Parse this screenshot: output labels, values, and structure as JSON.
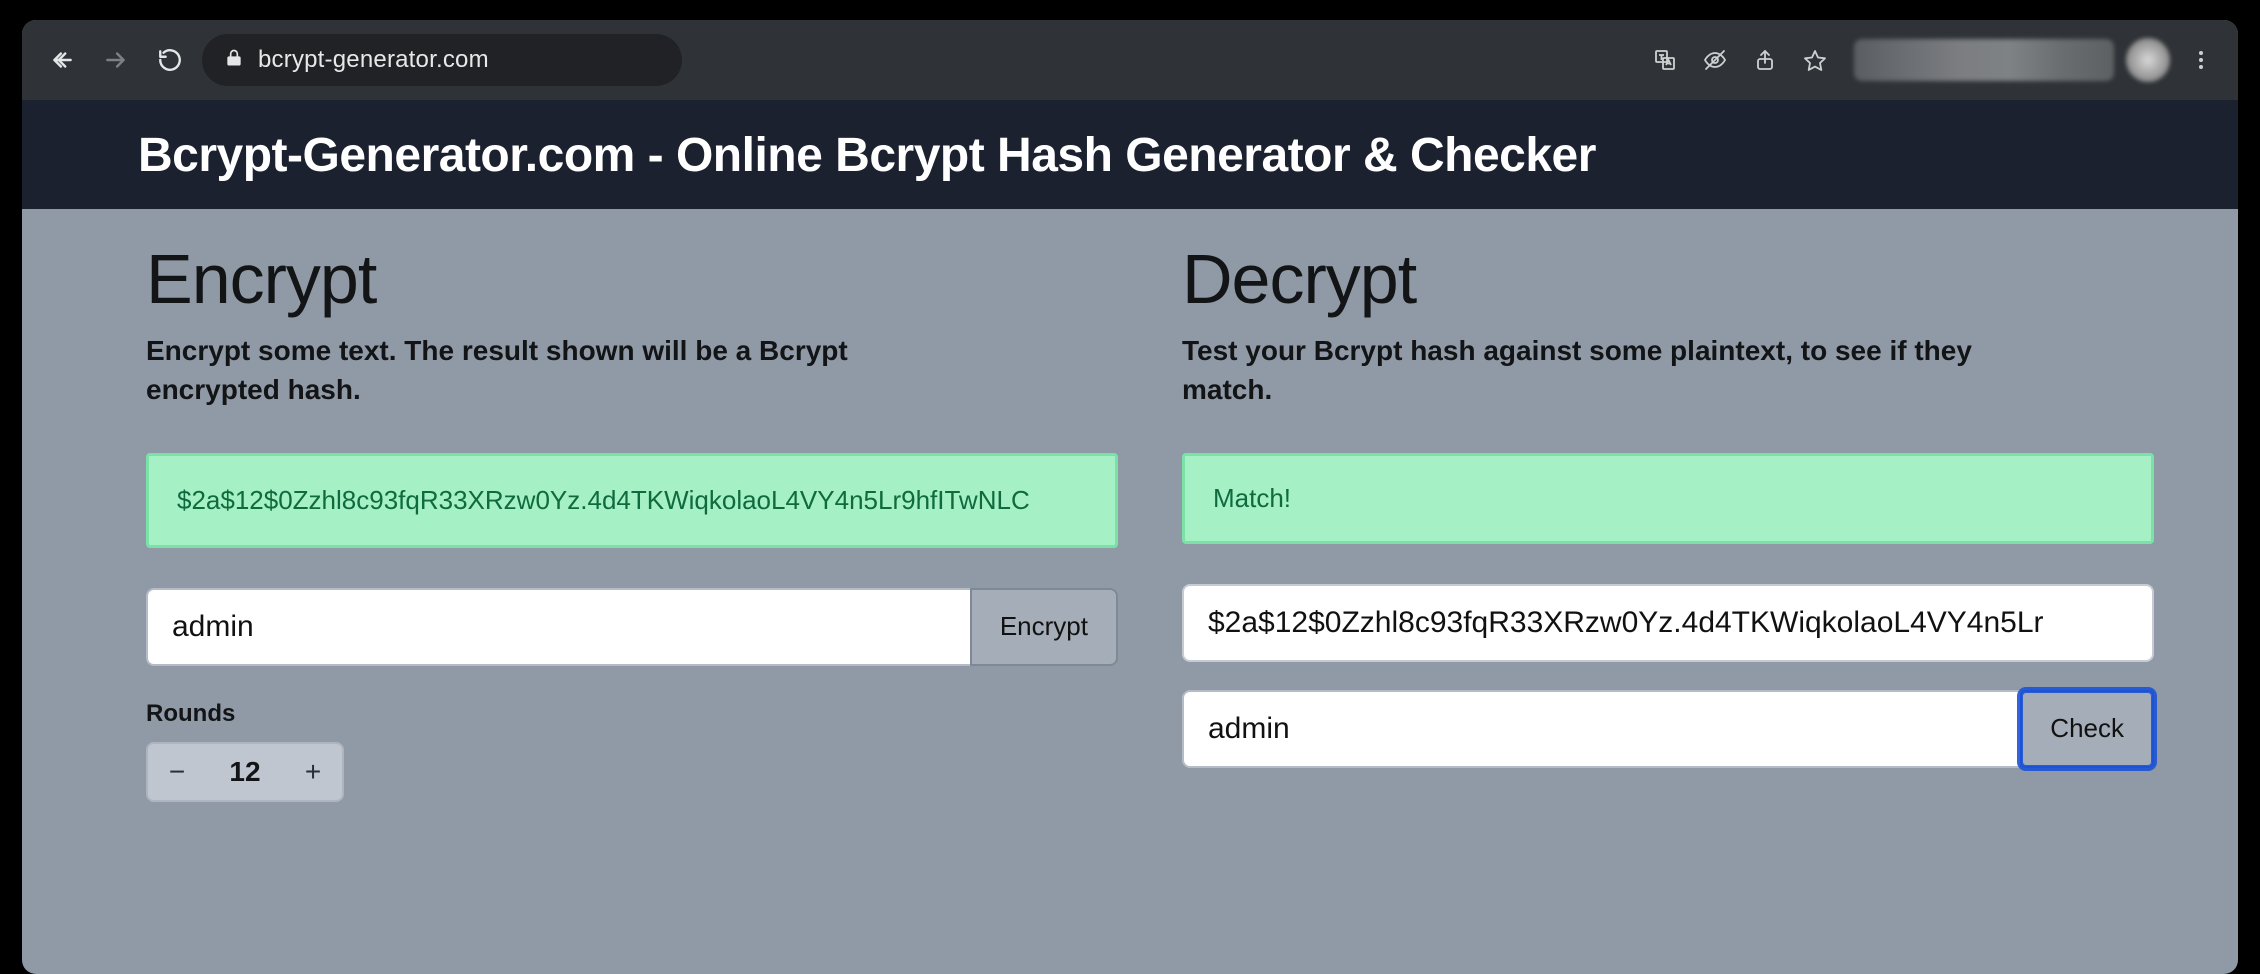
{
  "browser": {
    "url": "bcrypt-generator.com"
  },
  "header": {
    "title": "Bcrypt-Generator.com - Online Bcrypt Hash Generator & Checker"
  },
  "encrypt": {
    "title": "Encrypt",
    "subtitle": "Encrypt some text. The result shown will be a Bcrypt encrypted hash.",
    "result": "$2a$12$0Zzhl8c93fqR33XRzw0Yz.4d4TKWiqkolaoL4VY4n5Lr9hfITwNLC",
    "plaintext": "admin",
    "button": "Encrypt",
    "rounds_label": "Rounds",
    "rounds_value": "12"
  },
  "decrypt": {
    "title": "Decrypt",
    "subtitle": "Test your Bcrypt hash against some plaintext, to see if they match.",
    "result": "Match!",
    "hash_value": "$2a$12$0Zzhl8c93fqR33XRzw0Yz.4d4TKWiqkolaoL4VY4n5Lr",
    "plaintext": "admin",
    "button": "Check"
  }
}
